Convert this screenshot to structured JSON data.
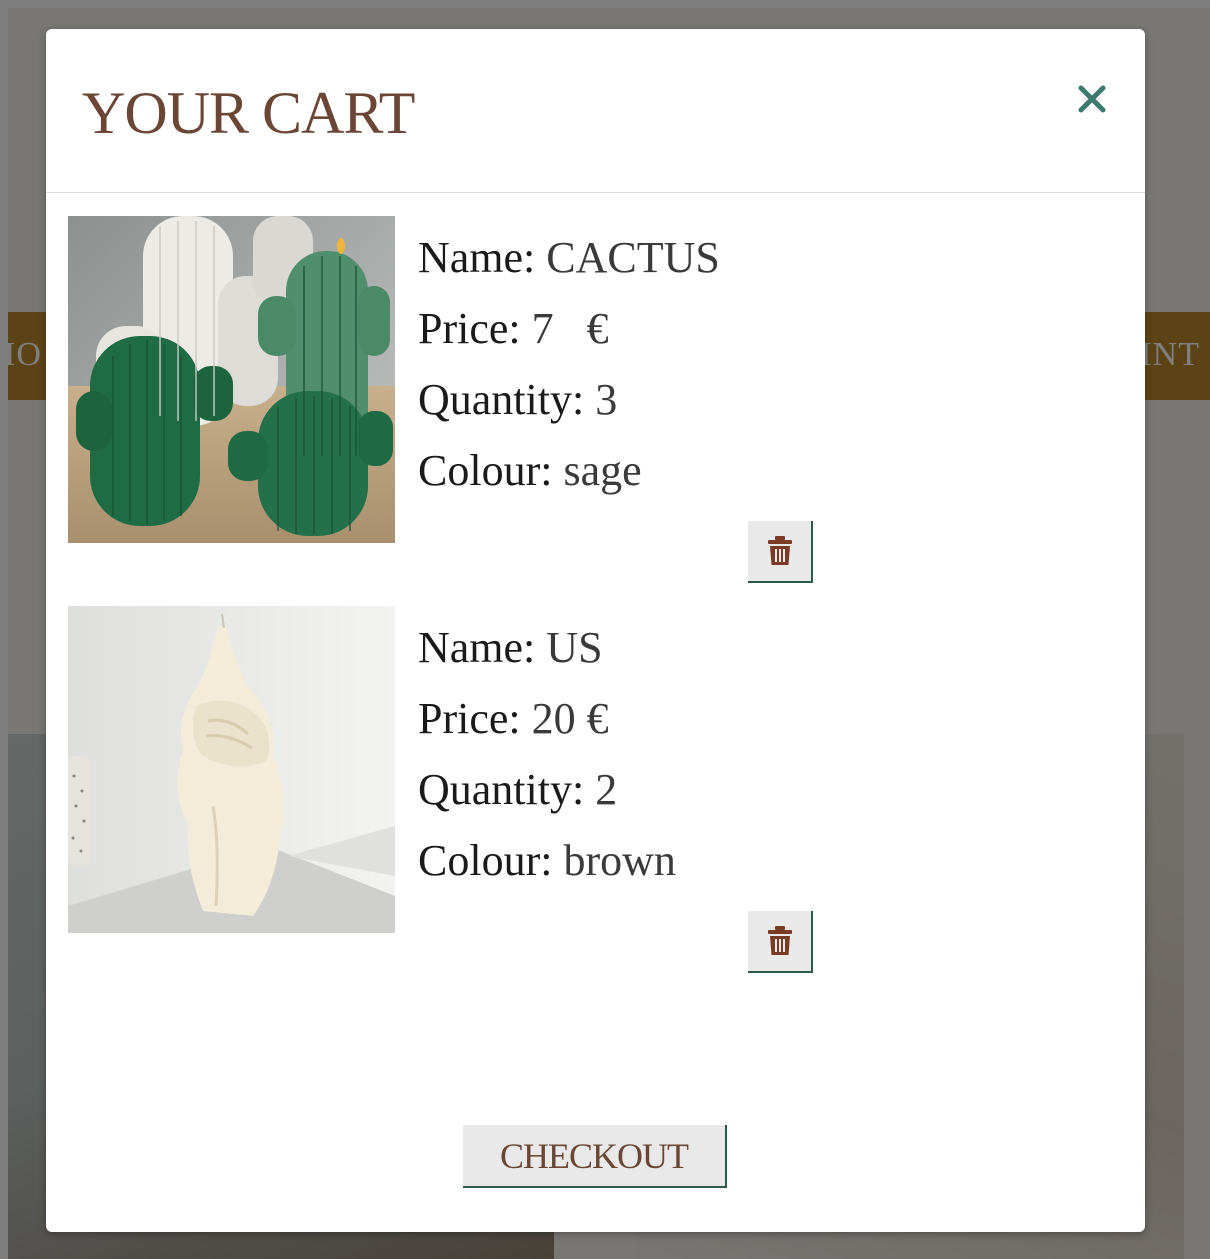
{
  "background": {
    "nav_left_fragment": "IO",
    "nav_right_fragment": "INT"
  },
  "modal": {
    "title": "YOUR CART",
    "close_icon": "close-icon",
    "checkout_label": "CHECKOUT"
  },
  "cart": {
    "items": [
      {
        "image": "cactus-candle-image",
        "name_label": "Name:",
        "name": " CACTUS",
        "price_label": "Price:",
        "price": " 7   €",
        "quantity_label": "Quantity:",
        "quantity": " 3",
        "colour_label": "Colour:",
        "colour": " sage",
        "delete_icon": "trash-icon"
      },
      {
        "image": "hands-candle-image",
        "name_label": "Name:",
        "name": " US",
        "price_label": "Price:",
        "price": " 20 €",
        "quantity_label": "Quantity:",
        "quantity": " 2",
        "colour_label": "Colour:",
        "colour": " brown",
        "delete_icon": "trash-icon"
      }
    ]
  },
  "colors": {
    "title_brown": "#6b4634",
    "close_teal": "#3d7a6e",
    "trash_brown": "#7a3b24",
    "button_border_green": "#2d5a4a",
    "nav_gold": "#b8862b"
  }
}
